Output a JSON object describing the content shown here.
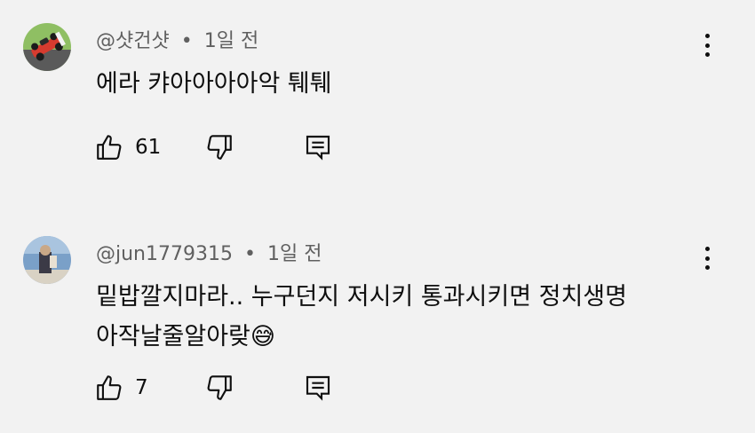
{
  "comments": [
    {
      "author": "@샷건샷",
      "separator": "•",
      "time": "1일 전",
      "text": "에라 캬아아아아악 퉤퉤",
      "likes": "61"
    },
    {
      "author": "@jun1779315",
      "separator": "•",
      "time": "1일 전",
      "text": "밑밥깔지마라.. 누구던지 저시키 통과시키면 정치생명\n아작날줄알아랒😅",
      "likes": "7"
    }
  ],
  "icons": {
    "like": "thumbs-up-icon",
    "dislike": "thumbs-down-icon",
    "reply": "reply-comment-icon",
    "more": "more-vertical-icon"
  },
  "colors": {
    "background": "#f2f2f2",
    "text": "#0f0f0f",
    "meta": "#606060"
  }
}
